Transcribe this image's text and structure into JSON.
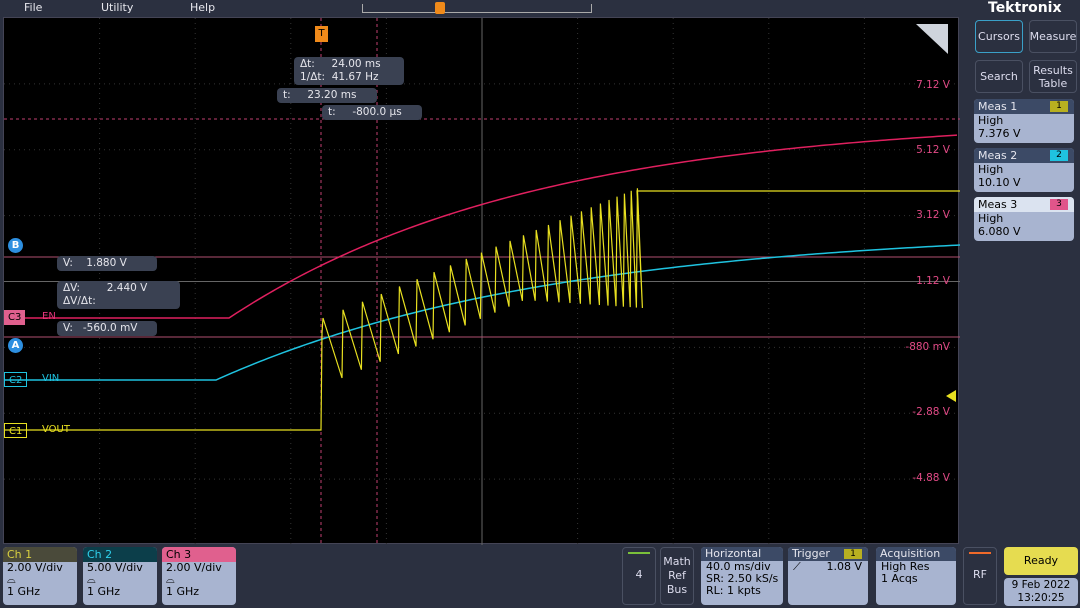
{
  "menu": {
    "file": "File",
    "utility": "Utility",
    "help": "Help"
  },
  "trigger_marker": "T",
  "readouts": {
    "delta_t": "Δt:     24.00 ms\n1/Δt:  41.67 Hz",
    "t1": "t:     23.20 ms",
    "t2": "t:     -800.0 µs",
    "vb": "V:    1.880 V",
    "dv": "ΔV:        2.440 V\nΔV/Δt:",
    "va": "V:   -560.0 mV"
  },
  "cursor_labels": {
    "a": "A",
    "b": "B"
  },
  "volt_labels": [
    "7.12 V",
    "5.12 V",
    "3.12 V",
    "1.12 V",
    "-880 mV",
    "-2.88 V",
    "-4.88 V"
  ],
  "channels_tags": [
    {
      "tag": "C3",
      "name": "EN",
      "color": "#e0357a"
    },
    {
      "tag": "C2",
      "name": "VIN",
      "color": "#1fc3e0"
    },
    {
      "tag": "C1",
      "name": "VOUT",
      "color": "#e8e020"
    }
  ],
  "sidebar": {
    "logo": "Tektronix",
    "cursors": "Cursors",
    "measure": "Measure",
    "search": "Search",
    "results_table": "Results Table",
    "meas": [
      {
        "title": "Meas 1",
        "badge": "1",
        "type": "High",
        "value": "7.376 V",
        "color": "#b8b020"
      },
      {
        "title": "Meas 2",
        "badge": "2",
        "type": "High",
        "value": "10.10 V",
        "color": "#1fc3e0"
      },
      {
        "title": "Meas 3",
        "badge": "3",
        "type": "High",
        "value": "6.080 V",
        "color": "#e0558a"
      }
    ]
  },
  "bottom": {
    "channels": [
      {
        "title": "Ch 1",
        "scale": "2.00 V/div",
        "bw": "1 GHz",
        "hd": "#4a4a3a",
        "hdtext": "#d8d040"
      },
      {
        "title": "Ch 2",
        "scale": "5.00 V/div",
        "bw": "1 GHz",
        "hd": "#0c3e4a",
        "hdtext": "#2fd0ec"
      },
      {
        "title": "Ch 3",
        "scale": "2.00 V/div",
        "bw": "1 GHz",
        "hd": "#e0608e",
        "hdtext": "#000"
      }
    ],
    "add_channel": "4",
    "math": "Math",
    "ref": "Ref",
    "bus": "Bus",
    "horizontal": {
      "title": "Horizontal",
      "scale": "40.0 ms/div",
      "sr": "SR: 2.50 kS/s",
      "rl": "RL: 1 kpts"
    },
    "trigger": {
      "title": "Trigger",
      "source": "1",
      "level": "1.08 V"
    },
    "acquisition": {
      "title": "Acquisition",
      "mode": "High Res",
      "count": "1 Acqs"
    },
    "rf": "RF",
    "status": "Ready",
    "date": "9 Feb 2022",
    "time": "13:20:25"
  }
}
